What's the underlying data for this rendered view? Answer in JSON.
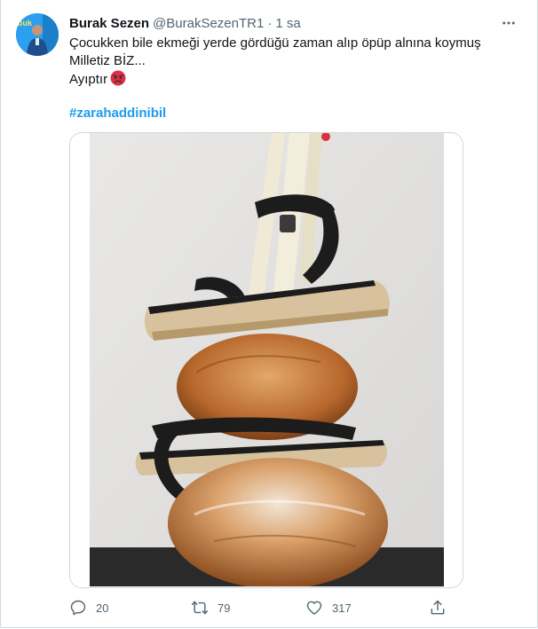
{
  "tweet": {
    "author_name": "Burak Sezen",
    "author_handle": "@BurakSezenTR1",
    "separator": "·",
    "timestamp": "1 sa",
    "text_lines": [
      "Çocukken bile ekmeği yerde gördüğü zaman alıp öpüp alnına koymuş",
      "Milletiz BİZ...",
      "Ayıptır"
    ],
    "emoji": "angry-face-emoji",
    "hashtag": "#zarahaddinibil",
    "avatar_text": "buk",
    "media": {
      "description_icon": "photo-sandals-on-bread"
    },
    "actions": {
      "replies": "20",
      "retweets": "79",
      "likes": "317"
    }
  },
  "colors": {
    "link": "#1d9bf0",
    "secondary_text": "#536471",
    "border": "#cfd9de",
    "avatar_bg": "#2aa0ee"
  },
  "icons": [
    "more-icon",
    "reply-icon",
    "retweet-icon",
    "like-icon",
    "share-icon"
  ]
}
